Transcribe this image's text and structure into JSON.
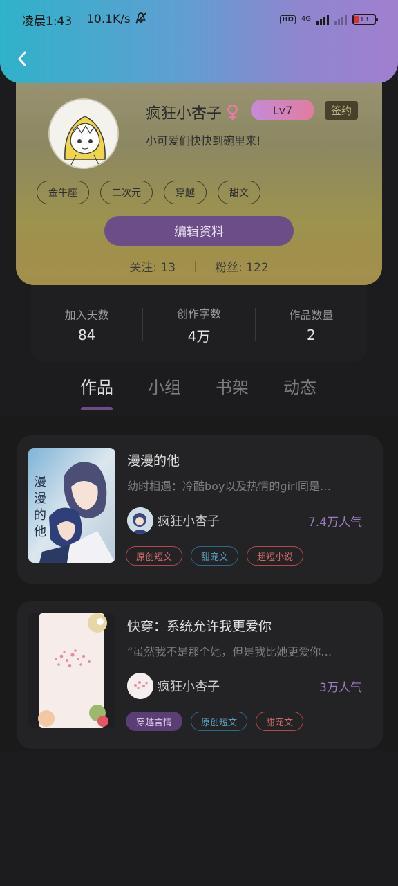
{
  "status_bar": {
    "time": "凌晨1:43",
    "speed": "10.1K/s",
    "hd": "HD",
    "network": "4G",
    "battery": "13"
  },
  "profile": {
    "username": "疯狂小杏子",
    "gender_symbol": "♀",
    "level": "Lv7",
    "signed_label": "签约",
    "bio": "小可爱们快快到碗里来!",
    "tags": [
      "金牛座",
      "二次元",
      "穿越",
      "甜文"
    ],
    "edit_button": "编辑资料",
    "following": "关注: 13",
    "followers": "粉丝: 122"
  },
  "stats": [
    {
      "label": "加入天数",
      "value": "84"
    },
    {
      "label": "创作字数",
      "value": "4万"
    },
    {
      "label": "作品数量",
      "value": "2"
    }
  ],
  "tabs": [
    "作品",
    "小组",
    "书架",
    "动态"
  ],
  "works": [
    {
      "title": "漫漫的他",
      "cover_text": "漫漫的他",
      "description": "幼时相遇：冷酷boy以及热情的girl同是…",
      "author": "疯狂小杏子",
      "popularity": "7.4万人气",
      "tags": [
        {
          "label": "原创短文",
          "style": "red"
        },
        {
          "label": "甜宠文",
          "style": "cyan"
        },
        {
          "label": "超短小说",
          "style": "red"
        }
      ]
    },
    {
      "title": "快穿：系统允许我更爱你",
      "description": "“虽然我不是那个她，但是我比她更爱你…",
      "author": "疯狂小杏子",
      "popularity": "3万人气",
      "tags": [
        {
          "label": "穿越言情",
          "style": "purple"
        },
        {
          "label": "原创短文",
          "style": "cyan"
        },
        {
          "label": "甜宠文",
          "style": "red"
        }
      ]
    }
  ],
  "colors": {
    "accent": "#6c4d88",
    "popularity": "#9b7cc0",
    "header_start": "#2fb2c9",
    "header_end": "#a07fcf"
  }
}
